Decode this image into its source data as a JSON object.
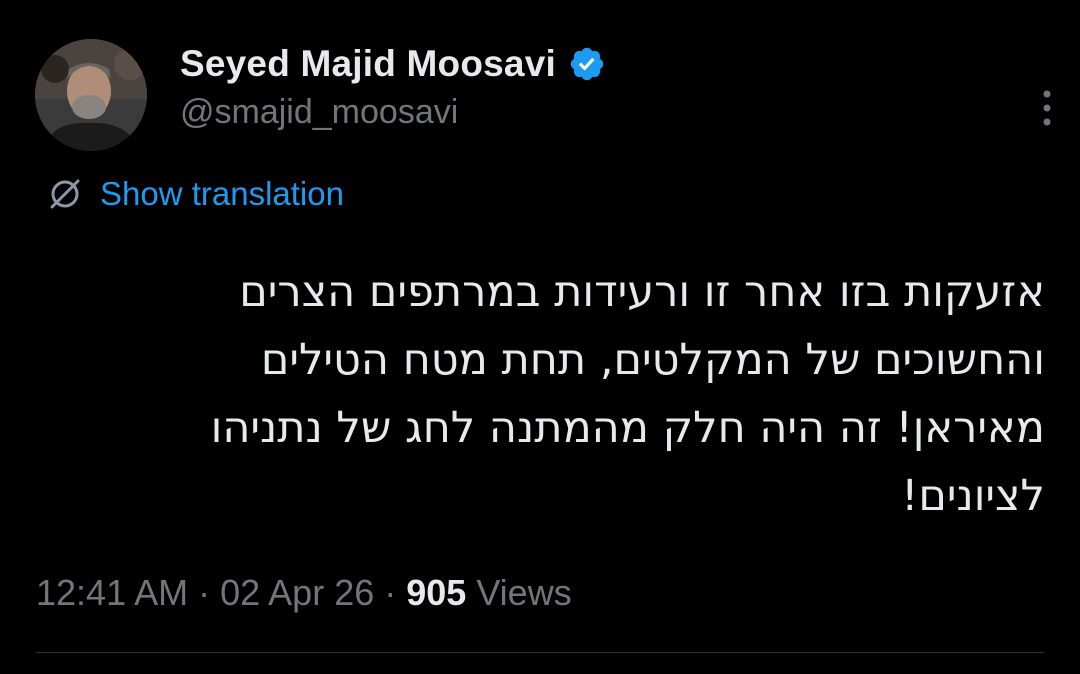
{
  "author": {
    "display_name": "Seyed Majid Moosavi",
    "handle": "@smajid_moosavi",
    "verified_icon": "verified-badge-icon",
    "avatar_icon": "profile-photo"
  },
  "translation": {
    "label": "Show translation",
    "icon": "globe-icon"
  },
  "tweet": {
    "lines": [
      "אזעקות בזו אחר זו ורעידות במרתפים הצרים",
      "והחשוכים של המקלטים, תחת מטח הטילים",
      "מאיראן! זה היה חלק מהמתנה לחג של נתניהו",
      "לציונים!"
    ]
  },
  "meta": {
    "time": "12:41 AM",
    "sep1": " · ",
    "date": "02 Apr 26",
    "sep2": " · ",
    "views_count": "905",
    "views_label": " Views"
  },
  "colors": {
    "background": "#000000",
    "text": "#e7e9ea",
    "secondary": "#71767b",
    "accent": "#1d9bf0"
  }
}
